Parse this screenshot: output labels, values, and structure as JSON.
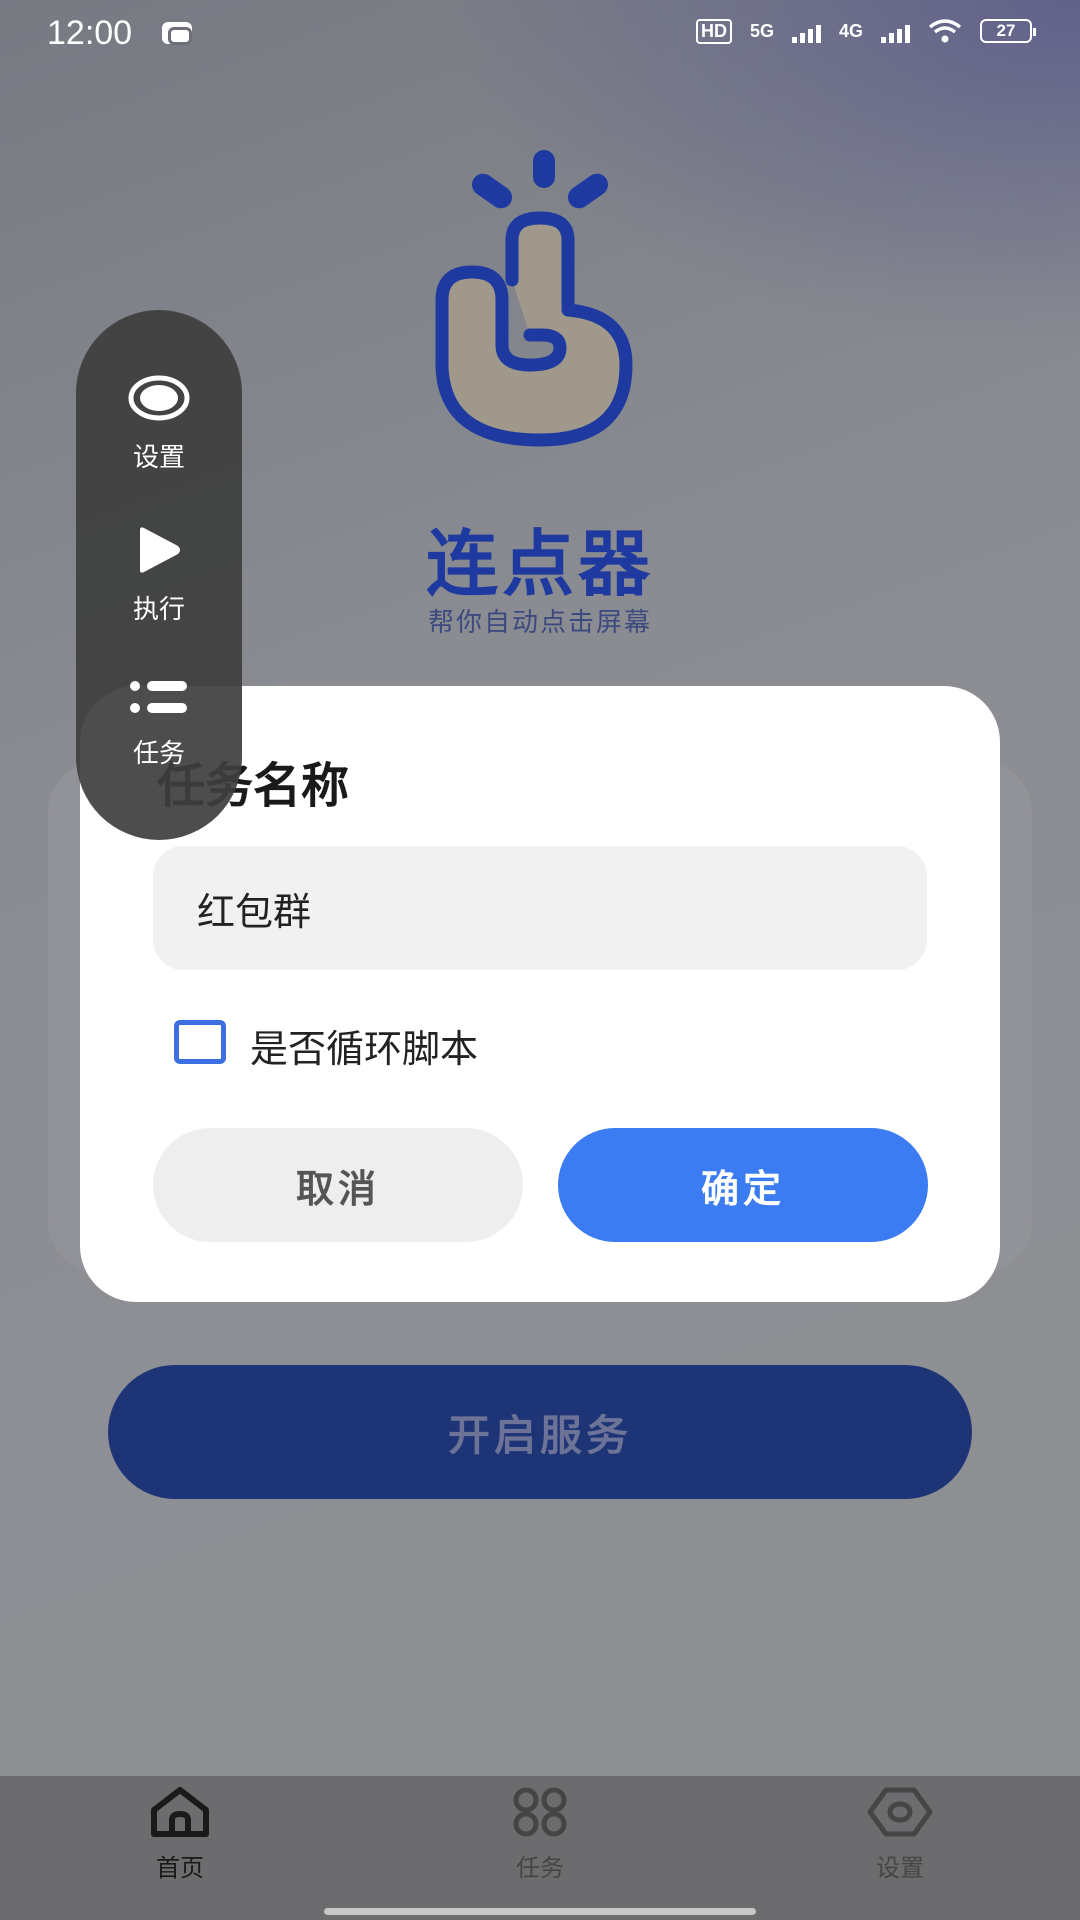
{
  "status_bar": {
    "time": "12:00",
    "network_labels": [
      "HD",
      "5G",
      "4G"
    ],
    "battery": "27"
  },
  "app": {
    "title": "连点器",
    "subtitle": "帮你自动点击屏幕"
  },
  "floating_panel": {
    "items": [
      {
        "label": "设置",
        "icon": "eye-icon"
      },
      {
        "label": "执行",
        "icon": "play-icon"
      },
      {
        "label": "任务",
        "icon": "list-icon"
      }
    ]
  },
  "dialog": {
    "title": "任务名称",
    "task_name_value": "红包群",
    "loop_label": "是否循环脚本",
    "loop_checked": false,
    "cancel_label": "取消",
    "confirm_label": "确定"
  },
  "start_button_label": "开启服务",
  "bottom_nav": {
    "items": [
      {
        "label": "首页",
        "icon": "home-icon",
        "active": true
      },
      {
        "label": "任务",
        "icon": "grid-icon",
        "active": false
      },
      {
        "label": "设置",
        "icon": "settings-icon",
        "active": false
      }
    ]
  },
  "colors": {
    "brand": "#1e3aa0",
    "accent": "#3b7cf3",
    "start_button": "#1d3477"
  }
}
